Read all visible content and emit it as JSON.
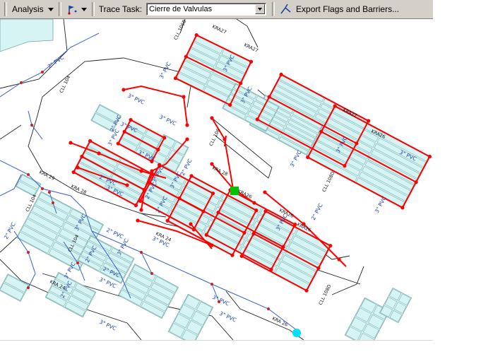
{
  "toolbar": {
    "analysis_label": "Analysis",
    "trace_task_label": "Trace Task:",
    "trace_task_value": "Cierre de Valvulas",
    "export_label": "Export Flags and Barriers..."
  },
  "icons": {
    "flag_tool": "flag-icon",
    "export": "trace-line-icon",
    "dropdown": "chevron-down-icon"
  },
  "colors": {
    "parcel_fill": "#d6f4f4",
    "parcel_stroke": "#6fa6a6",
    "trace_red": "#ff0000",
    "pipe_blue": "#3a5fd0",
    "flag_green": "#00c000",
    "barrier_cyan": "#00e0ff"
  },
  "map": {
    "street_labels": [
      "KRA27",
      "KRA27",
      "CLL 106B",
      "CLL 104",
      "KRA 29",
      "KRA 28",
      "KRA26",
      "KRA 24",
      "KRA27",
      "KRA26",
      "CLL 104",
      "CLL 108D",
      "KRA26",
      "KRA26",
      "CLL 104",
      "CLL 106",
      "KRA 24",
      "KRA 26",
      "CLL 108D",
      "KRA 28"
    ],
    "pipe_labels": [
      "2\" PVC",
      "3\" PVC",
      "2\" PVC",
      "3\" PVC",
      "3\" PVC",
      "3\" PVC",
      "3\" PVC",
      "3\" PVC",
      "2\" PVC",
      "3\" PVC",
      "3\" PVC",
      "3\" PVC",
      "2\" PVC",
      "3\" PVC",
      "2\" PVC",
      "3\" PVC",
      "2\" PVC",
      "3\" PVC",
      "3\" PVC",
      "3\" PVC",
      "2\" PVC",
      "3\" PVC",
      "3\" PVC",
      "3\" PVC",
      "2\" PVC",
      "3\" PVC",
      "2\" PVC",
      "2\" PVC",
      "3\" PVC",
      "3\" PVC",
      "3\" PVC",
      "2\" PVC",
      "3\" PVC",
      "3\" PVC",
      "2\" PVC",
      "3\" PVC"
    ]
  }
}
